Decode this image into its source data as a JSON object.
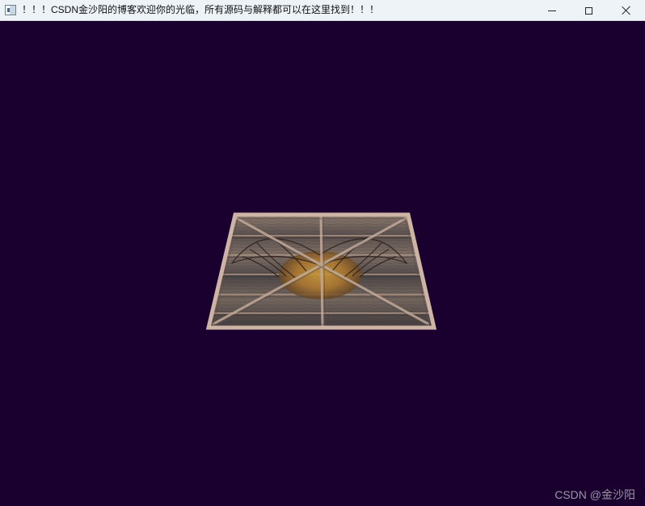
{
  "window": {
    "title": "！！！CSDN金沙阳的博客欢迎你的光临，所有源码与解释都可以在这里找到！！！",
    "controls": {
      "minimize": "minimize",
      "maximize": "maximize",
      "close": "close"
    }
  },
  "viewport": {
    "background": "#19002f"
  },
  "scene": {
    "object": "textured-wooden-plane",
    "colors": {
      "wood_dark": "#4d4546",
      "wood_light": "#8d7d72",
      "frame": "#b9a094",
      "emblem": "#b7832f",
      "wing": "#2c201c"
    }
  },
  "watermark": {
    "text": "CSDN @金沙阳"
  }
}
